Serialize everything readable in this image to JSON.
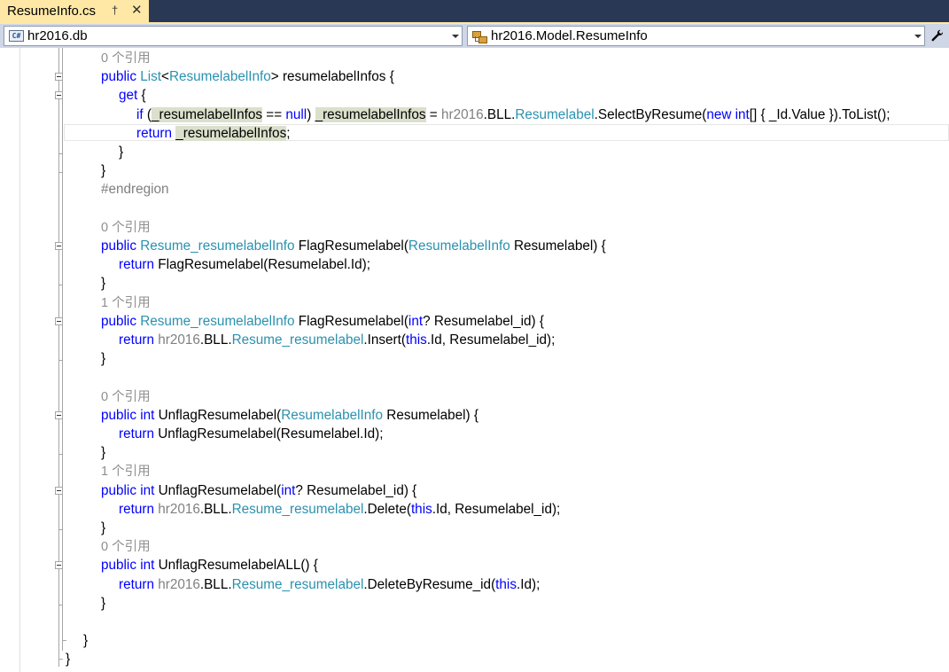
{
  "tab": {
    "title": "ResumeInfo.cs",
    "pin_glyph": "†",
    "close_glyph": "✕",
    "pin_icon": "pin-icon",
    "close_icon": "close-icon"
  },
  "navbar": {
    "project_dropdown": "hr2016.db",
    "project_icon": "csharp-project-icon",
    "project_icon_text": "C#",
    "type_dropdown": "hr2016.Model.ResumeInfo",
    "type_icon": "class-icon",
    "wrench_glyph": "🔧",
    "wrench_icon": "wrench-icon"
  },
  "colors": {
    "tab_active": "#ffe8a6",
    "tab_strip": "#293955",
    "navbar": "#cfd6e5",
    "keyword": "#0000ff",
    "type": "#2b91af",
    "muted": "#808080",
    "codelens": "#8f8f8f",
    "highlight": "#dbe0cc"
  },
  "code_lines": [
    {
      "indent": 114,
      "tokens": [
        {
          "t": "0 个引用",
          "c": "lens"
        }
      ]
    },
    {
      "indent": 114,
      "tokens": [
        {
          "t": "public ",
          "c": "kw"
        },
        {
          "t": "List",
          "c": "ty"
        },
        {
          "t": "<",
          "c": ""
        },
        {
          "t": "ResumelabelInfo",
          "c": "ty"
        },
        {
          "t": "> resumelabelInfos {",
          "c": ""
        }
      ]
    },
    {
      "indent": 134,
      "tokens": [
        {
          "t": "get",
          "c": "kw"
        },
        {
          "t": " {",
          "c": ""
        }
      ]
    },
    {
      "indent": 154,
      "tokens": [
        {
          "t": "if",
          "c": "kw"
        },
        {
          "t": " (",
          "c": ""
        },
        {
          "t": "_resumelabelInfos",
          "c": "hl"
        },
        {
          "t": " == ",
          "c": ""
        },
        {
          "t": "null",
          "c": "kw"
        },
        {
          "t": ") ",
          "c": ""
        },
        {
          "t": "_resumelabelInfos",
          "c": "hl"
        },
        {
          "t": " = ",
          "c": ""
        },
        {
          "t": "hr2016",
          "c": "mu"
        },
        {
          "t": ".BLL.",
          "c": ""
        },
        {
          "t": "Resumelabel",
          "c": "ty"
        },
        {
          "t": ".SelectByResume(",
          "c": ""
        },
        {
          "t": "new",
          "c": "kw"
        },
        {
          "t": " ",
          "c": ""
        },
        {
          "t": "int",
          "c": "kw"
        },
        {
          "t": "[] { _Id.Value }).ToList();",
          "c": ""
        }
      ]
    },
    {
      "indent": 154,
      "current": true,
      "tokens": [
        {
          "t": "return",
          "c": "kw"
        },
        {
          "t": " ",
          "c": ""
        },
        {
          "t": "_resumelabelInfos",
          "c": "hl"
        },
        {
          "t": ";",
          "c": ""
        }
      ]
    },
    {
      "indent": 134,
      "tokens": [
        {
          "t": "}",
          "c": ""
        }
      ]
    },
    {
      "indent": 114,
      "tokens": [
        {
          "t": "}",
          "c": ""
        }
      ]
    },
    {
      "indent": 114,
      "tokens": [
        {
          "t": "#endregion",
          "c": "pp"
        }
      ]
    },
    {
      "indent": 114,
      "tokens": []
    },
    {
      "indent": 114,
      "tokens": [
        {
          "t": "0 个引用",
          "c": "lens"
        }
      ]
    },
    {
      "indent": 114,
      "tokens": [
        {
          "t": "public ",
          "c": "kw"
        },
        {
          "t": "Resume_resumelabelInfo",
          "c": "ty"
        },
        {
          "t": " FlagResumelabel(",
          "c": ""
        },
        {
          "t": "ResumelabelInfo",
          "c": "ty"
        },
        {
          "t": " Resumelabel) {",
          "c": ""
        }
      ]
    },
    {
      "indent": 134,
      "tokens": [
        {
          "t": "return",
          "c": "kw"
        },
        {
          "t": " FlagResumelabel(Resumelabel.Id);",
          "c": ""
        }
      ]
    },
    {
      "indent": 114,
      "tokens": [
        {
          "t": "}",
          "c": ""
        }
      ]
    },
    {
      "indent": 114,
      "tokens": [
        {
          "t": "1 个引用",
          "c": "lens"
        }
      ]
    },
    {
      "indent": 114,
      "tokens": [
        {
          "t": "public ",
          "c": "kw"
        },
        {
          "t": "Resume_resumelabelInfo",
          "c": "ty"
        },
        {
          "t": " FlagResumelabel(",
          "c": ""
        },
        {
          "t": "int",
          "c": "kw"
        },
        {
          "t": "? Resumelabel_id) {",
          "c": ""
        }
      ]
    },
    {
      "indent": 134,
      "tokens": [
        {
          "t": "return",
          "c": "kw"
        },
        {
          "t": " ",
          "c": ""
        },
        {
          "t": "hr2016",
          "c": "mu"
        },
        {
          "t": ".BLL.",
          "c": ""
        },
        {
          "t": "Resume_resumelabel",
          "c": "ty"
        },
        {
          "t": ".Insert(",
          "c": ""
        },
        {
          "t": "this",
          "c": "kw"
        },
        {
          "t": ".Id, Resumelabel_id);",
          "c": ""
        }
      ]
    },
    {
      "indent": 114,
      "tokens": [
        {
          "t": "}",
          "c": ""
        }
      ]
    },
    {
      "indent": 114,
      "tokens": []
    },
    {
      "indent": 114,
      "tokens": [
        {
          "t": "0 个引用",
          "c": "lens"
        }
      ]
    },
    {
      "indent": 114,
      "tokens": [
        {
          "t": "public ",
          "c": "kw"
        },
        {
          "t": "int",
          "c": "kw"
        },
        {
          "t": " UnflagResumelabel(",
          "c": ""
        },
        {
          "t": "ResumelabelInfo",
          "c": "ty"
        },
        {
          "t": " Resumelabel) {",
          "c": ""
        }
      ]
    },
    {
      "indent": 134,
      "tokens": [
        {
          "t": "return",
          "c": "kw"
        },
        {
          "t": " UnflagResumelabel(Resumelabel.Id);",
          "c": ""
        }
      ]
    },
    {
      "indent": 114,
      "tokens": [
        {
          "t": "}",
          "c": ""
        }
      ]
    },
    {
      "indent": 114,
      "tokens": [
        {
          "t": "1 个引用",
          "c": "lens"
        }
      ]
    },
    {
      "indent": 114,
      "tokens": [
        {
          "t": "public ",
          "c": "kw"
        },
        {
          "t": "int",
          "c": "kw"
        },
        {
          "t": " UnflagResumelabel(",
          "c": ""
        },
        {
          "t": "int",
          "c": "kw"
        },
        {
          "t": "? Resumelabel_id) {",
          "c": ""
        }
      ]
    },
    {
      "indent": 134,
      "tokens": [
        {
          "t": "return",
          "c": "kw"
        },
        {
          "t": " ",
          "c": ""
        },
        {
          "t": "hr2016",
          "c": "mu"
        },
        {
          "t": ".BLL.",
          "c": ""
        },
        {
          "t": "Resume_resumelabel",
          "c": "ty"
        },
        {
          "t": ".Delete(",
          "c": ""
        },
        {
          "t": "this",
          "c": "kw"
        },
        {
          "t": ".Id, Resumelabel_id);",
          "c": ""
        }
      ]
    },
    {
      "indent": 114,
      "tokens": [
        {
          "t": "}",
          "c": ""
        }
      ]
    },
    {
      "indent": 114,
      "tokens": [
        {
          "t": "0 个引用",
          "c": "lens"
        }
      ]
    },
    {
      "indent": 114,
      "tokens": [
        {
          "t": "public ",
          "c": "kw"
        },
        {
          "t": "int",
          "c": "kw"
        },
        {
          "t": " UnflagResumelabelALL() {",
          "c": ""
        }
      ]
    },
    {
      "indent": 134,
      "tokens": [
        {
          "t": "return",
          "c": "kw"
        },
        {
          "t": " ",
          "c": ""
        },
        {
          "t": "hr2016",
          "c": "mu"
        },
        {
          "t": ".BLL.",
          "c": ""
        },
        {
          "t": "Resume_resumelabel",
          "c": "ty"
        },
        {
          "t": ".DeleteByResume_id(",
          "c": ""
        },
        {
          "t": "this",
          "c": "kw"
        },
        {
          "t": ".Id);",
          "c": ""
        }
      ]
    },
    {
      "indent": 114,
      "tokens": [
        {
          "t": "}",
          "c": ""
        }
      ]
    },
    {
      "indent": 114,
      "tokens": []
    },
    {
      "indent": 94,
      "tokens": [
        {
          "t": "}",
          "c": ""
        }
      ]
    },
    {
      "indent": 74,
      "tokens": [
        {
          "t": "}",
          "c": ""
        }
      ]
    }
  ]
}
